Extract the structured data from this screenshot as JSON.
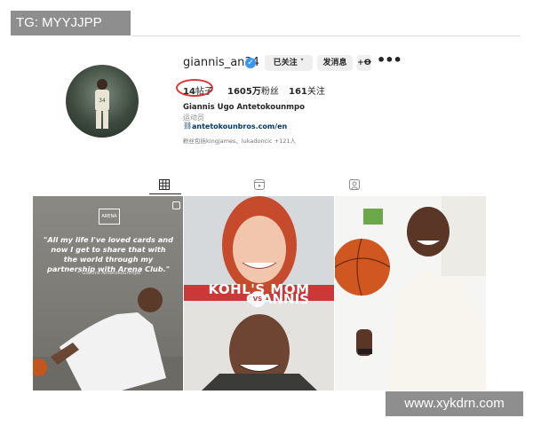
{
  "watermark": {
    "top": "TG: MYYJJPP",
    "bottom": "www.xykdrn.com"
  },
  "profile": {
    "username": "giannis_an34",
    "verified_mark": "✓",
    "follow_button": "已关注 ˅",
    "message_button": "发消息",
    "add_user_icon": "+Ꝋ",
    "more_menu": "•••",
    "posts_count": "14",
    "posts_label": "帖子",
    "followers_count": "1605万",
    "followers_label": "粉丝",
    "following_count": "161",
    "following_label": "关注",
    "full_name": "Giannis Ugo Antetokounmpo",
    "category": "运动员",
    "link_icon": "⛓",
    "link": "antetokounbros.com/en",
    "followed_by": "粉丝包括kingjames、lukadoncic +121人"
  },
  "tabs": [
    {
      "name": "posts",
      "icon": "grid-icon",
      "active": true
    },
    {
      "name": "reels",
      "icon": "reels-icon",
      "active": false
    },
    {
      "name": "tagged",
      "icon": "tagged-icon",
      "active": false
    }
  ],
  "posts": {
    "post1": {
      "logo": "ARENA",
      "quote": "\"All my life I've loved cards and now I get to share that with the world through my partnership with Arena Club.\"",
      "author": "~ Giannis Antetokounmpo"
    },
    "post2": {
      "title": "KOHL'S MOM",
      "vs": "VS",
      "name": "GIANNIS"
    },
    "post3": {}
  },
  "colors": {
    "accent": "#3897f0",
    "highlight_ring": "#d83a3a",
    "post2_bg": "#cc3838",
    "watermark_bg": "#8e8e8e"
  }
}
